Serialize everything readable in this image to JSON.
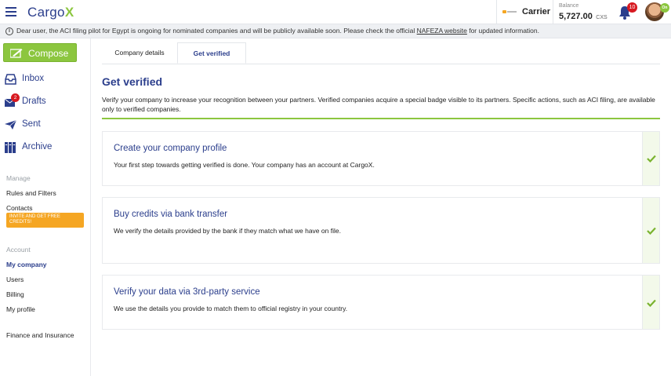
{
  "header": {
    "logo_text": "Cargo",
    "logo_x": "X",
    "role": "Carrier",
    "balance_label": "Balance",
    "balance_value": "5,727.00",
    "balance_unit": "CXS",
    "notifications_count": "10",
    "online_badge": "On"
  },
  "info_banner": {
    "text_before": "Dear user, the ACI filing pilot for Egypt is ongoing for nominated companies and will be publicly available soon. Please check the official ",
    "link_text": "NAFEZA website",
    "text_after": " for updated information."
  },
  "sidebar": {
    "compose_label": "Compose",
    "nav": [
      {
        "label": "Inbox"
      },
      {
        "label": "Drafts",
        "badge": "2"
      },
      {
        "label": "Sent"
      },
      {
        "label": "Archive"
      }
    ],
    "manage_label": "Manage",
    "manage_items": [
      "Rules and Filters",
      "Contacts"
    ],
    "invite_label": "INVITE AND GET FREE CREDITS!",
    "account_label": "Account",
    "account_items": [
      "My company",
      "Users",
      "Billing",
      "My profile"
    ],
    "finance_label": "Finance and Insurance"
  },
  "main": {
    "tabs": [
      {
        "label": "Company details"
      },
      {
        "label": "Get verified"
      }
    ],
    "title": "Get verified",
    "intro": "Verify your company to increase your recognition between your partners. Verified companies acquire a special badge visible to its partners. Specific actions, such as ACI filing, are available only to verified companies.",
    "steps": [
      {
        "title": "Create your company profile",
        "description": "Your first step towards getting verified is done. Your company has an account at CargoX."
      },
      {
        "title": "Buy credits via bank transfer",
        "description": "We verify the details provided by the bank if they match what we have on file."
      },
      {
        "title": "Verify your data via 3rd-party service",
        "description": "We use the details you provide to match them to official registry in your country."
      }
    ]
  },
  "colors": {
    "brand_blue": "#2b3e8c",
    "brand_green": "#8cc63f",
    "badge_red": "#d71920",
    "invite_orange": "#f5a623"
  }
}
